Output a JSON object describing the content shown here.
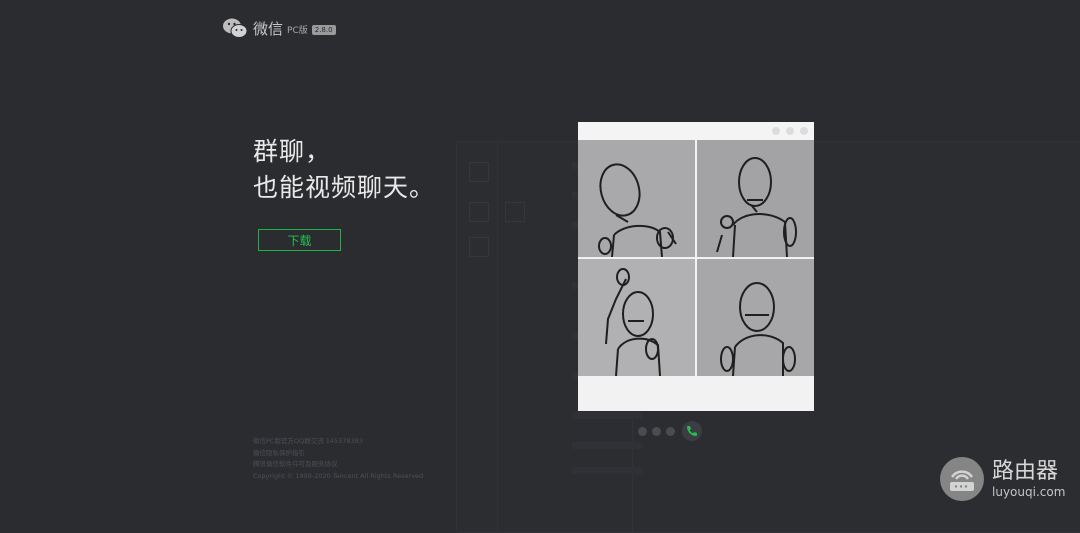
{
  "header": {
    "brand": "微信",
    "pc_label": "PC版",
    "version": "2.8.0"
  },
  "hero": {
    "line1": "群聊，",
    "line2": "也能视频聊天。",
    "download_label": "下载"
  },
  "footer": {
    "lines": [
      "微信PC版官方QQ群交流 145378383",
      "微信隐私保护指引",
      "腾讯微信软件许可及服务协议",
      "Copyright © 1998-2020 Tencent All Rights Reserved"
    ]
  },
  "watermark": {
    "title": "路由器",
    "url": "luyouqi.com"
  },
  "colors": {
    "background": "#2b2c30",
    "accent_green": "#22c14f"
  }
}
